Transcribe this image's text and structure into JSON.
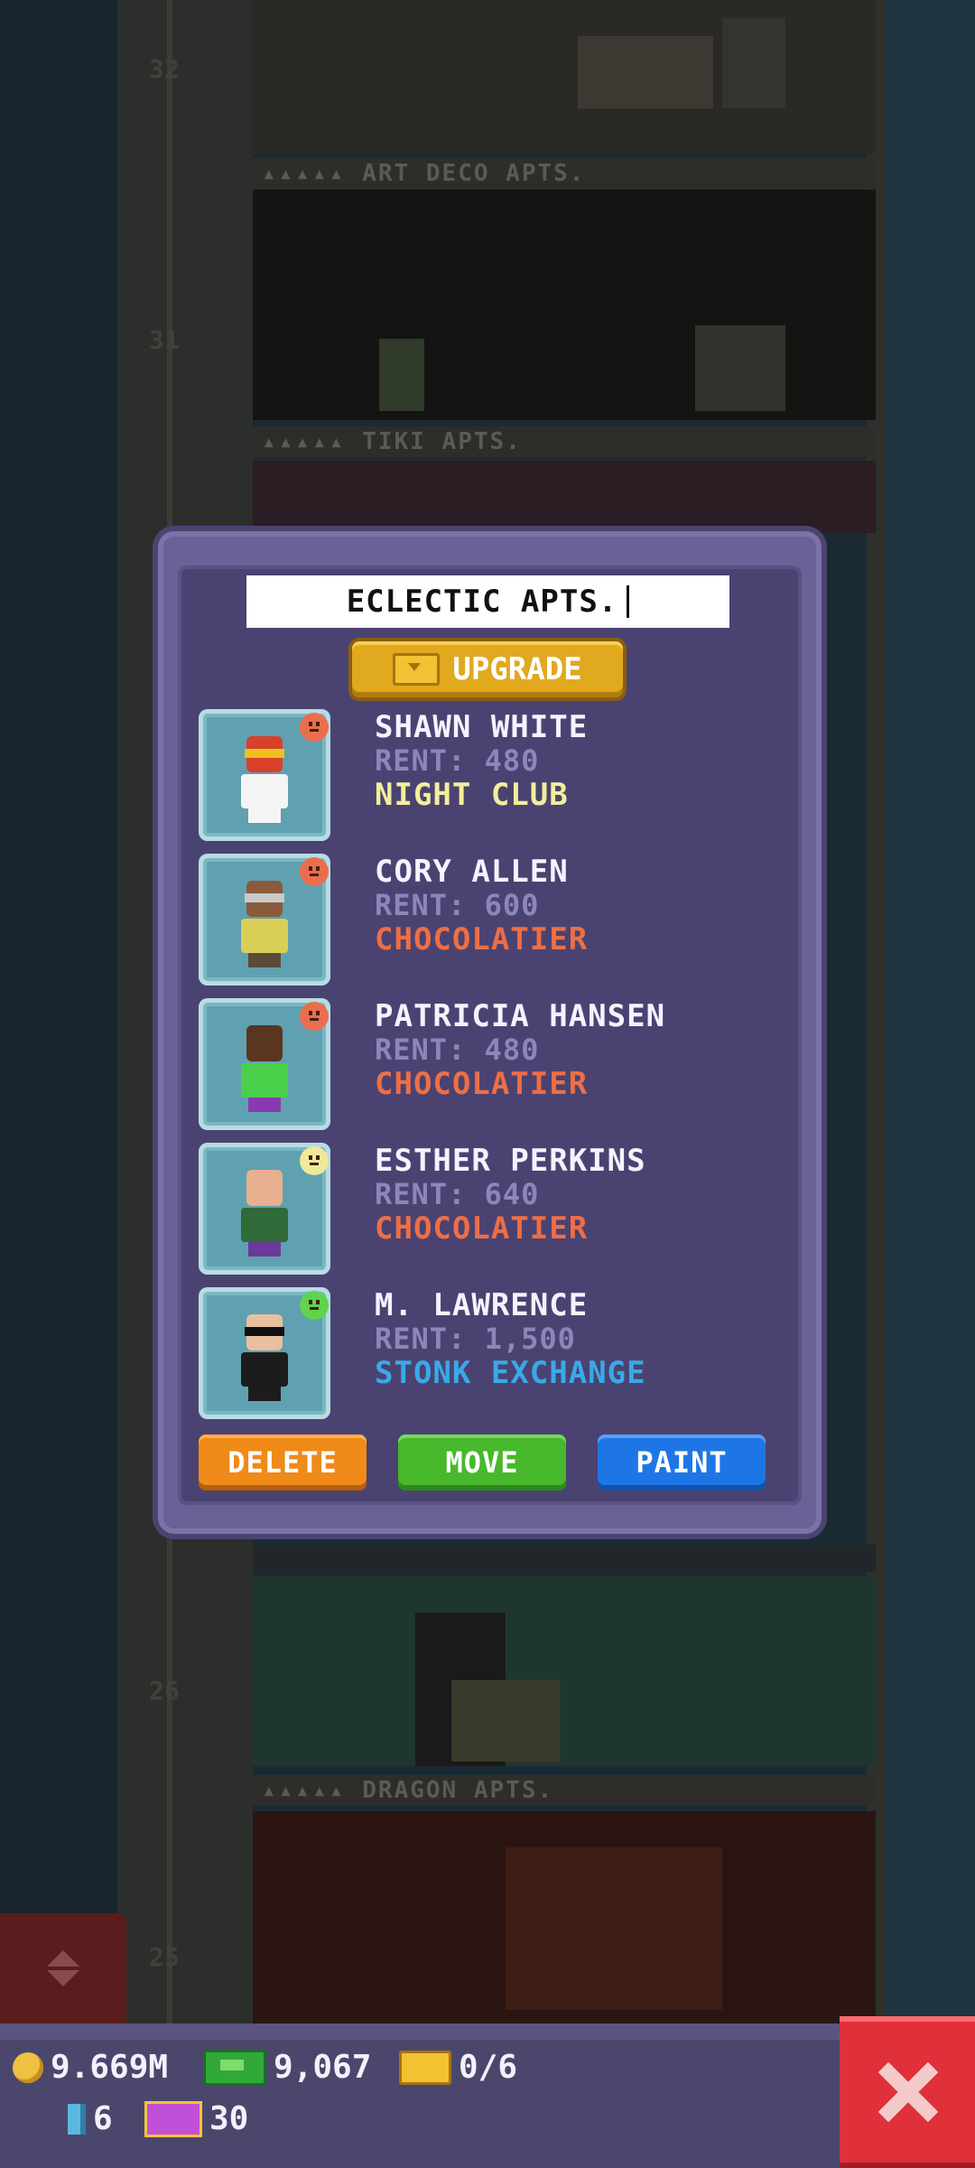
{
  "background": {
    "floors": [
      {
        "number": "32",
        "label": "ART DECO APTS."
      },
      {
        "number": "31",
        "label": "TIKI APTS."
      },
      {
        "number": "26",
        "label": "DRAGON APTS."
      },
      {
        "number": "25",
        "label": ""
      }
    ]
  },
  "dialog": {
    "name_value": "ECLECTIC APTS.",
    "upgrade_label": "UPGRADE",
    "residents": [
      {
        "name": "SHAWN WHITE",
        "rent": "RENT: 480",
        "job": "NIGHT CLUB",
        "job_color": "#f3ee9a",
        "mood": "sad"
      },
      {
        "name": "CORY ALLEN",
        "rent": "RENT: 600",
        "job": "CHOCOLATIER",
        "job_color": "#ee6e45",
        "mood": "sad"
      },
      {
        "name": "PATRICIA HANSEN",
        "rent": "RENT: 480",
        "job": "CHOCOLATIER",
        "job_color": "#ee6e45",
        "mood": "sad"
      },
      {
        "name": "ESTHER PERKINS",
        "rent": "RENT: 640",
        "job": "CHOCOLATIER",
        "job_color": "#ee6e45",
        "mood": "neutral"
      },
      {
        "name": "M. LAWRENCE",
        "rent": "RENT: 1,500",
        "job": "STONK EXCHANGE",
        "job_color": "#3aa9e8",
        "mood": "happy"
      }
    ],
    "delete_label": "DELETE",
    "move_label": "MOVE",
    "paint_label": "PAINT"
  },
  "hud": {
    "coins": "9.669M",
    "bucks": "9,067",
    "bux_progress": "0/6",
    "keys": "6",
    "vip": "30"
  },
  "colors": {
    "dialog_bg": "#4a4372",
    "upgrade": "#e0a91e",
    "delete": "#f08a18",
    "move": "#48b82c",
    "paint": "#1e76e6",
    "close": "#e0303a"
  }
}
